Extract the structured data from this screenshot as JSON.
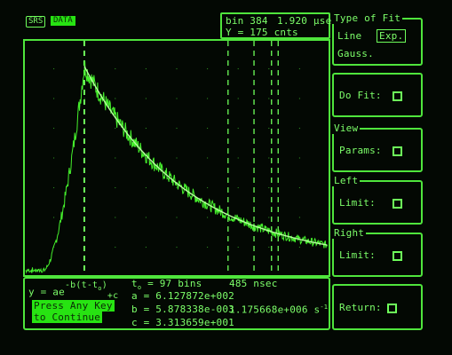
{
  "header": {
    "brand": "SRS",
    "mode": "DATA",
    "cursor_bin": "bin 384",
    "cursor_time": "1.920 μsec",
    "cursor_y": "Y = 175 cnts"
  },
  "fit_panel": {
    "type_title": "Type of Fit",
    "line_label": "Line",
    "exp_label": "Exp.",
    "gauss_label": "Gauss.",
    "do_fit_label": "Do Fit:",
    "view_title": "View",
    "params_label": "Params:",
    "left_title": "Left",
    "left_limit_label": "Limit:",
    "right_title": "Right",
    "right_limit_label": "Limit:",
    "return_label": "Return:"
  },
  "results": {
    "formula_main": "y = ae",
    "formula_exp": "-b(t-t",
    "formula_sub": "o",
    "formula_close": ")",
    "formula_tail": "+c",
    "press_any": "Press Any Key",
    "to_continue": "to Continue",
    "t0_label": "t",
    "t0_sub": "o",
    "t0_value": "= 97 bins",
    "t0_time": "485 nsec",
    "a_line": "a = 6.127872e+002",
    "b_line": "b = 5.878338e-003",
    "b_rate": "1.175668e+006 s",
    "b_rate_exp": "-1",
    "c_line": "c = 3.313659e+001"
  },
  "chart_data": {
    "type": "line",
    "description_series": "decay histogram with exponential fit",
    "x_range_bins": [
      0,
      500
    ],
    "peak_bin": 97,
    "fit": {
      "a": 612.7872,
      "b": 0.005878338,
      "c": 33.13659,
      "t0": 97
    },
    "markers_bins": [
      97,
      335,
      378,
      407,
      418
    ]
  }
}
